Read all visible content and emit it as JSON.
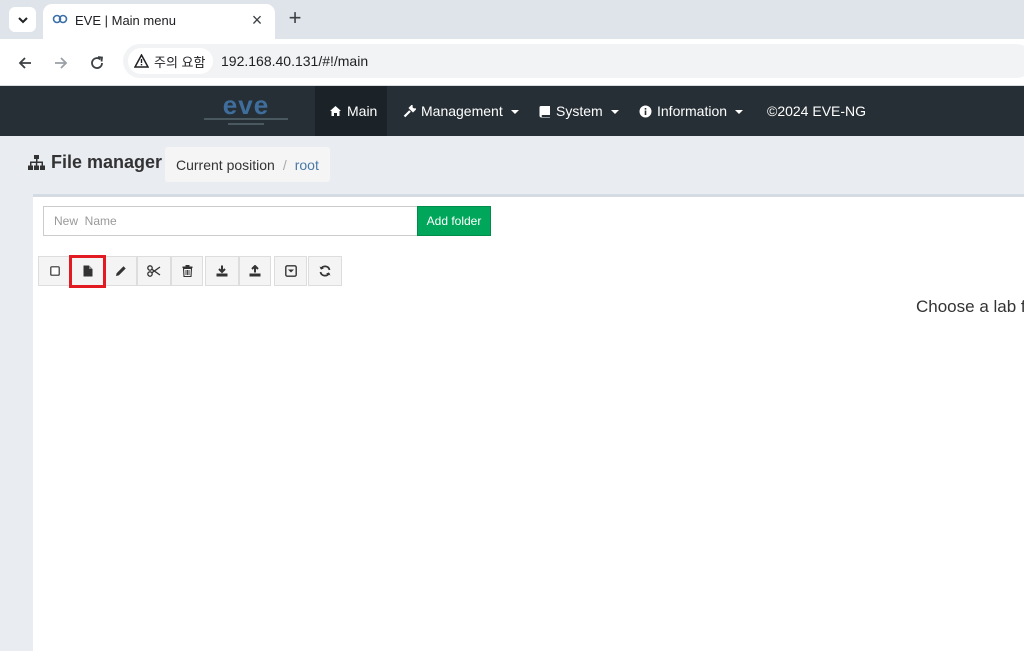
{
  "browser": {
    "tab_title": "EVE | Main menu",
    "security_label": "주의 요함",
    "url": "192.168.40.131/#!/main"
  },
  "navbar": {
    "items": [
      {
        "label": "Main",
        "icon": "home-icon",
        "active": true
      },
      {
        "label": "Management",
        "icon": "wrench-icon",
        "dropdown": true
      },
      {
        "label": "System",
        "icon": "book-icon",
        "dropdown": true
      },
      {
        "label": "Information",
        "icon": "info-icon",
        "dropdown": true
      },
      {
        "label": "©2024 EVE-NG"
      }
    ]
  },
  "file_manager": {
    "title": "File manager",
    "breadcrumb": {
      "current_label": "Current position",
      "root": "root"
    },
    "new_name_placeholder": "New  Name",
    "add_folder_label": "Add folder",
    "toolbar_icons": [
      "checkbox-icon",
      "file-icon",
      "pencil-icon",
      "scissors-icon",
      "trash-icon",
      "download-icon",
      "upload-icon",
      "export-icon",
      "refresh-icon"
    ]
  },
  "main_message": "Choose a lab fo",
  "colors": {
    "navbar_bg": "#262f35",
    "add_folder_bg": "#00a65a",
    "highlight_border": "#e21b23",
    "link": "#4a7aa8"
  }
}
